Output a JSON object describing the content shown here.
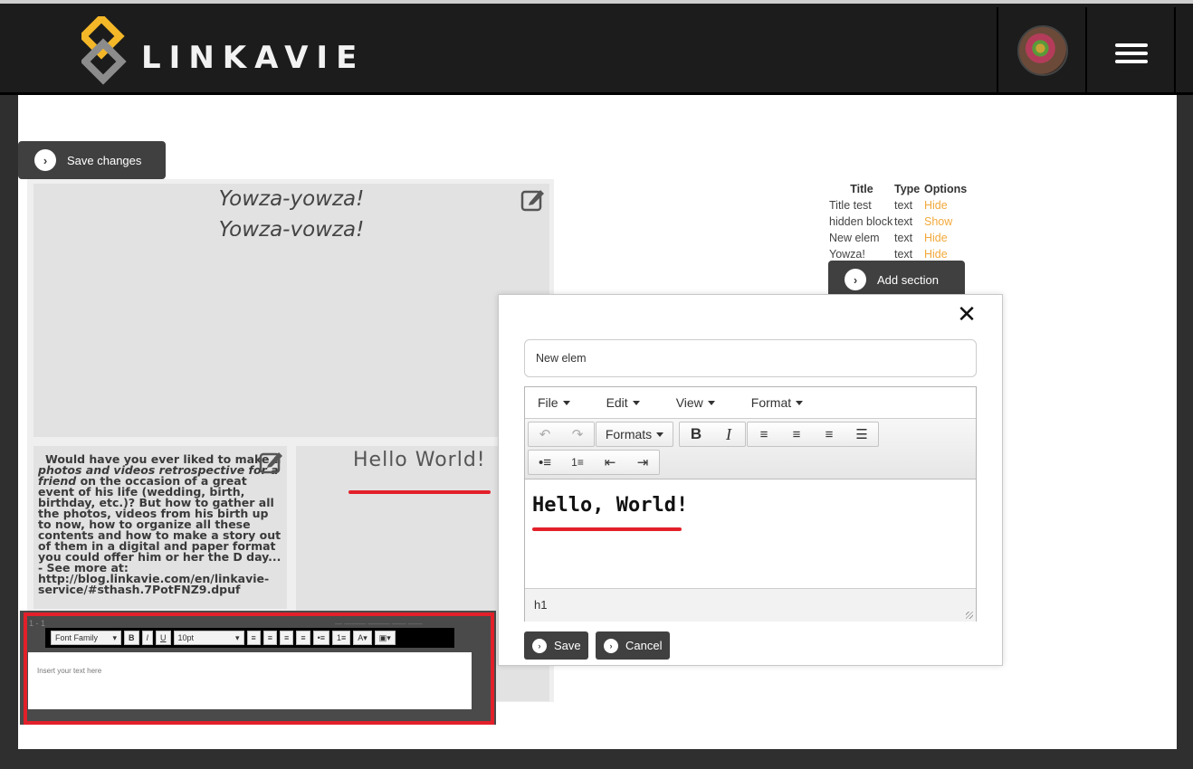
{
  "header": {
    "brand": "LINKAVIE",
    "menu_icon": "hamburger-icon",
    "avatar_icon": "user-avatar"
  },
  "main": {
    "save_changes_label": "Save changes",
    "add_section_label": "Add section",
    "blocks": {
      "yowza_line1": "Yowza-yowza!",
      "yowza_line2": "Yowza-yowza!",
      "story_text_bold_start": "Would have you ever liked to make a",
      "story_text_italic": "photos and videos retrospective for a friend",
      "story_text_rest": "on the occasion of a great event of his life (wedding, birth, birthday, etc.)? But how to gather all the photos, videos from his birth up to now, how to organize all these contents and how to make a story out of them in a digital and paper format you could offer him or her the D day... - See more at: http://blog.linkavie.com/en/linkavie-service/#sthash.7PotFNZ9.dpuf",
      "hello_text": "Hello  World!"
    },
    "old_editor": {
      "font_family": "Font Family",
      "font_size": "10pt",
      "placeholder": "Insert your text here",
      "bold": "B",
      "italic": "I",
      "underline": "U",
      "text_color": "A"
    },
    "sections_table": {
      "headers": [
        "Title",
        "Type",
        "Options"
      ],
      "rows": [
        {
          "title": "Title test",
          "type": "text",
          "option": "Hide"
        },
        {
          "title": "hidden block",
          "type": "text",
          "option": "Show"
        },
        {
          "title": "New elem",
          "type": "text",
          "option": "Hide"
        },
        {
          "title": "Yowza!",
          "type": "text",
          "option": "Hide"
        }
      ]
    }
  },
  "modal": {
    "title_value": "New elem",
    "menus": [
      "File",
      "Edit",
      "View",
      "Format"
    ],
    "formats_label": "Formats",
    "bold": "B",
    "italic": "I",
    "content_heading": "Hello, World!",
    "status_path": "h1",
    "save_label": "Save",
    "cancel_label": "Cancel",
    "colors": {
      "accent_red": "#e3202a",
      "option_orange": "#f2a93b",
      "button_dark": "#404040"
    }
  }
}
